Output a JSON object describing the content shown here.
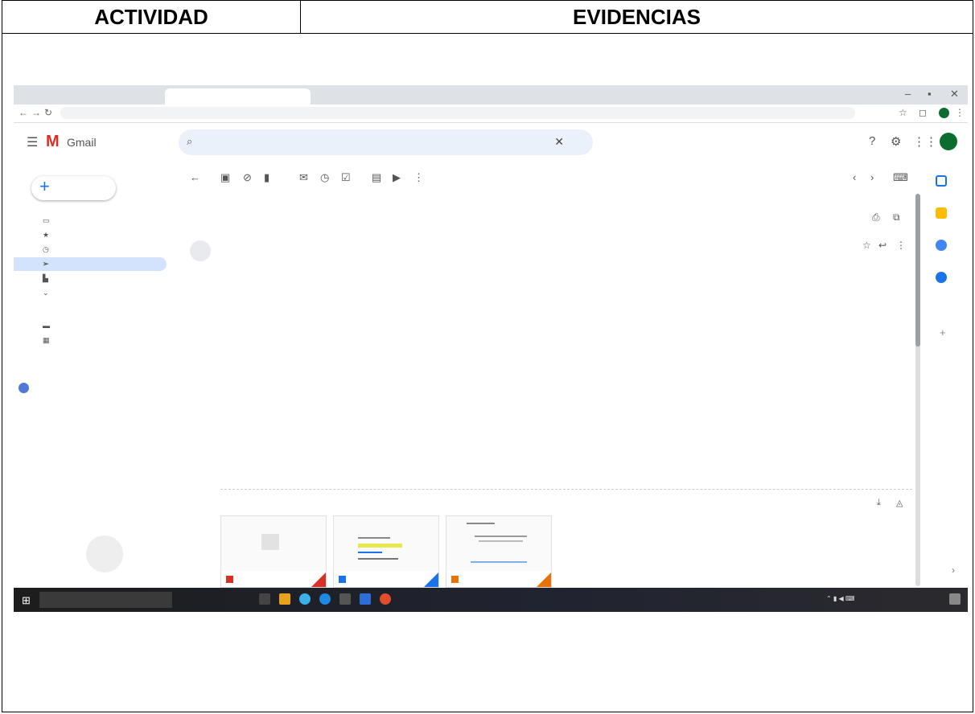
{
  "table": {
    "col1_header": "ACTIVIDAD",
    "col2_header": "EVIDENCIAS"
  },
  "browser": {
    "tabs": [
      "",
      "",
      "",
      ""
    ],
    "url": ""
  },
  "gmail": {
    "app_name": "Gmail",
    "compose_label": "",
    "search_query": "",
    "pagination": "",
    "nav_items": [
      {
        "label": "",
        "count": ""
      },
      {
        "label": "",
        "count": ""
      },
      {
        "label": "",
        "count": ""
      },
      {
        "label": "",
        "count": ""
      },
      {
        "label": "",
        "count": ""
      },
      {
        "label": "",
        "count": ""
      }
    ],
    "labels_header": "",
    "labels": [
      "",
      ""
    ],
    "hangouts_header": "",
    "hangouts_user": "",
    "hangouts_placeholder": "",
    "email": {
      "subject": "",
      "sender_name": "",
      "sender_email": "",
      "recipients": "",
      "cc_line": "",
      "date": "",
      "body_lines": [
        "",
        ""
      ],
      "closing": "",
      "signature": [
        "",
        "",
        ""
      ],
      "attachments_label": "",
      "attachments": [
        {
          "name": "",
          "icon_color": "#d93025"
        },
        {
          "name": "",
          "icon_color": "#1a73e8"
        },
        {
          "name": "",
          "icon_color": "#e8710a"
        }
      ],
      "actions": [
        "",
        "",
        ""
      ]
    }
  },
  "taskbar": {
    "search_placeholder": "",
    "time": "",
    "date": ""
  }
}
